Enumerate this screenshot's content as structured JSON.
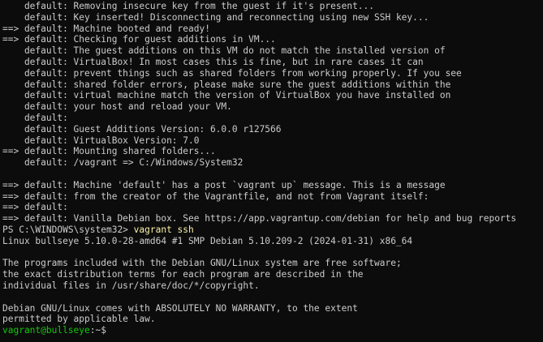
{
  "terminal": {
    "background": "#0c0c0c",
    "foreground": "#cccccc",
    "colors": {
      "user_host": "#16c60c",
      "command": "#f9f1a5"
    },
    "lines": [
      {
        "segments": [
          {
            "text": "    default: Removing insecure key from the guest if it's present..."
          }
        ]
      },
      {
        "segments": [
          {
            "text": "    default: Key inserted! Disconnecting and reconnecting using new SSH key..."
          }
        ]
      },
      {
        "segments": [
          {
            "text": "==> default: Machine booted and ready!"
          }
        ]
      },
      {
        "segments": [
          {
            "text": "==> default: Checking for guest additions in VM..."
          }
        ]
      },
      {
        "segments": [
          {
            "text": "    default: The guest additions on this VM do not match the installed version of"
          }
        ]
      },
      {
        "segments": [
          {
            "text": "    default: VirtualBox! In most cases this is fine, but in rare cases it can"
          }
        ]
      },
      {
        "segments": [
          {
            "text": "    default: prevent things such as shared folders from working properly. If you see"
          }
        ]
      },
      {
        "segments": [
          {
            "text": "    default: shared folder errors, please make sure the guest additions within the"
          }
        ]
      },
      {
        "segments": [
          {
            "text": "    default: virtual machine match the version of VirtualBox you have installed on"
          }
        ]
      },
      {
        "segments": [
          {
            "text": "    default: your host and reload your VM."
          }
        ]
      },
      {
        "segments": [
          {
            "text": "    default:"
          }
        ]
      },
      {
        "segments": [
          {
            "text": "    default: Guest Additions Version: 6.0.0 r127566"
          }
        ]
      },
      {
        "segments": [
          {
            "text": "    default: VirtualBox Version: 7.0"
          }
        ]
      },
      {
        "segments": [
          {
            "text": "==> default: Mounting shared folders..."
          }
        ]
      },
      {
        "segments": [
          {
            "text": "    default: /vagrant => C:/Windows/System32"
          }
        ]
      },
      {
        "segments": [
          {
            "text": ""
          }
        ]
      },
      {
        "segments": [
          {
            "text": "==> default: Machine 'default' has a post `vagrant up` message. This is a message"
          }
        ]
      },
      {
        "segments": [
          {
            "text": "==> default: from the creator of the Vagrantfile, and not from Vagrant itself:"
          }
        ]
      },
      {
        "segments": [
          {
            "text": "==> default:"
          }
        ]
      },
      {
        "segments": [
          {
            "text": "==> default: Vanilla Debian box. See https://app.vagrantup.com/debian for help and bug reports"
          }
        ]
      },
      {
        "segments": [
          {
            "text": "PS C:\\WINDOWS\\system32> "
          },
          {
            "text": "vagrant ssh",
            "color": "command"
          }
        ]
      },
      {
        "segments": [
          {
            "text": "Linux bullseye 5.10.0-28-amd64 #1 SMP Debian 5.10.209-2 (2024-01-31) x86_64"
          }
        ]
      },
      {
        "segments": [
          {
            "text": ""
          }
        ]
      },
      {
        "segments": [
          {
            "text": "The programs included with the Debian GNU/Linux system are free software;"
          }
        ]
      },
      {
        "segments": [
          {
            "text": "the exact distribution terms for each program are described in the"
          }
        ]
      },
      {
        "segments": [
          {
            "text": "individual files in /usr/share/doc/*/copyright."
          }
        ]
      },
      {
        "segments": [
          {
            "text": ""
          }
        ]
      },
      {
        "segments": [
          {
            "text": "Debian GNU/Linux comes with ABSOLUTELY NO WARRANTY, to the extent"
          }
        ]
      },
      {
        "segments": [
          {
            "text": "permitted by applicable law."
          }
        ]
      },
      {
        "segments": [
          {
            "text": "vagrant@bullseye",
            "color": "user_host"
          },
          {
            "text": ":~$ "
          }
        ]
      }
    ]
  }
}
